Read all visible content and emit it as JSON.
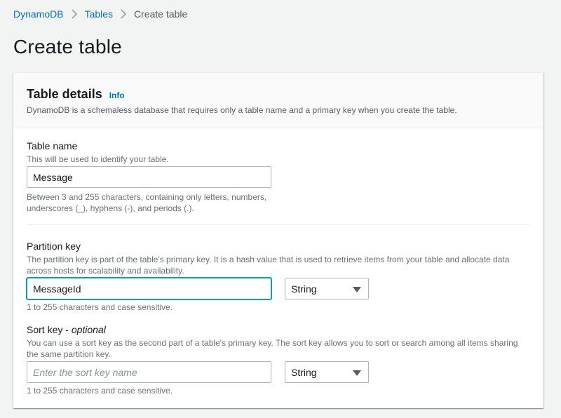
{
  "breadcrumb": {
    "items": [
      "DynamoDB",
      "Tables"
    ],
    "current": "Create table"
  },
  "page": {
    "title": "Create table"
  },
  "panel": {
    "title": "Table details",
    "info_label": "Info",
    "description": "DynamoDB is a schemaless database that requires only a table name and a primary key when you create the table."
  },
  "table_name": {
    "label": "Table name",
    "description": "This will be used to identify your table.",
    "value": "Message",
    "constraint_line1": "Between 3 and 255 characters, containing only letters, numbers,",
    "constraint_line2": "underscores (_), hyphens (-), and periods (.)."
  },
  "partition_key": {
    "label": "Partition key",
    "description": "The partition key is part of the table's primary key. It is a hash value that is used to retrieve items from your table and allocate data across hosts for scalability and availability.",
    "value": "MessageId",
    "type": "String",
    "constraint": "1 to 255 characters and case sensitive."
  },
  "sort_key": {
    "label": "Sort key",
    "label_suffix": "optional",
    "description": "You can use a sort key as the second part of a table's primary key. The sort key allows you to sort or search among all items sharing the same partition key.",
    "placeholder": "Enter the sort key name",
    "value": "",
    "type": "String",
    "constraint": "1 to 255 characters and case sensitive."
  },
  "colors": {
    "link": "#0073bb",
    "focus": "#00a1c9",
    "background": "#f2f3f3"
  }
}
